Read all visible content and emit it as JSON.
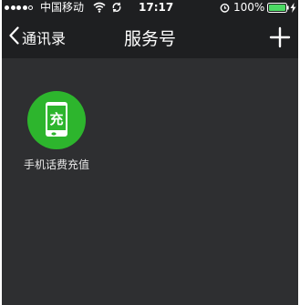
{
  "status_bar": {
    "carrier": "中国移动",
    "time": "17:17",
    "battery": "100%",
    "signal_strength": 4
  },
  "nav": {
    "back_label": "通讯录",
    "title": "服务号"
  },
  "services": [
    {
      "label": "手机话费充值",
      "icon_char": "充",
      "icon": "phone-recharge-icon"
    }
  ],
  "colors": {
    "background": "#2e2f31",
    "bar": "#1e1f21",
    "accent_green": "#2db52d",
    "battery_green": "#4cd964"
  }
}
